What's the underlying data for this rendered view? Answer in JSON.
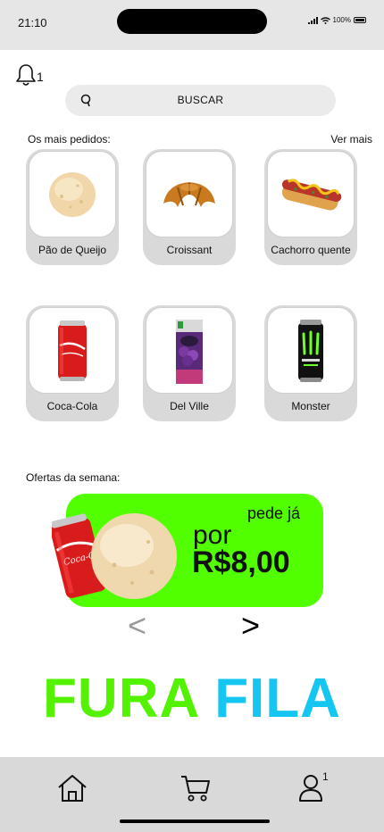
{
  "status_bar": {
    "time": "21:10",
    "battery": "100%"
  },
  "notifications": {
    "count": "1"
  },
  "search": {
    "label": "BUSCAR"
  },
  "popular": {
    "title": "Os mais pedidos:",
    "see_more": "Ver mais",
    "items": [
      {
        "label": "Pão de Queijo",
        "icon": "pao-de-queijo"
      },
      {
        "label": "Croissant",
        "icon": "croissant"
      },
      {
        "label": "Cachorro quente",
        "icon": "hot-dog"
      },
      {
        "label": "Coca-Cola",
        "icon": "coca-cola-can"
      },
      {
        "label": "Del Ville",
        "icon": "del-valle-juice"
      },
      {
        "label": "Monster",
        "icon": "monster-can"
      }
    ]
  },
  "offers": {
    "title": "Ofertas da semana:",
    "cta": "pede já",
    "prefix": "por",
    "price": "R$8,00",
    "can_text": "Coca-Cola",
    "prev": "<",
    "next": ">"
  },
  "brand": {
    "word1": "FURA",
    "word2": "FILA"
  },
  "bottom_nav": {
    "profile_badge": "1"
  },
  "colors": {
    "green": "#52ff00",
    "blue": "#14c6f0",
    "gray": "#d9d9d9"
  }
}
